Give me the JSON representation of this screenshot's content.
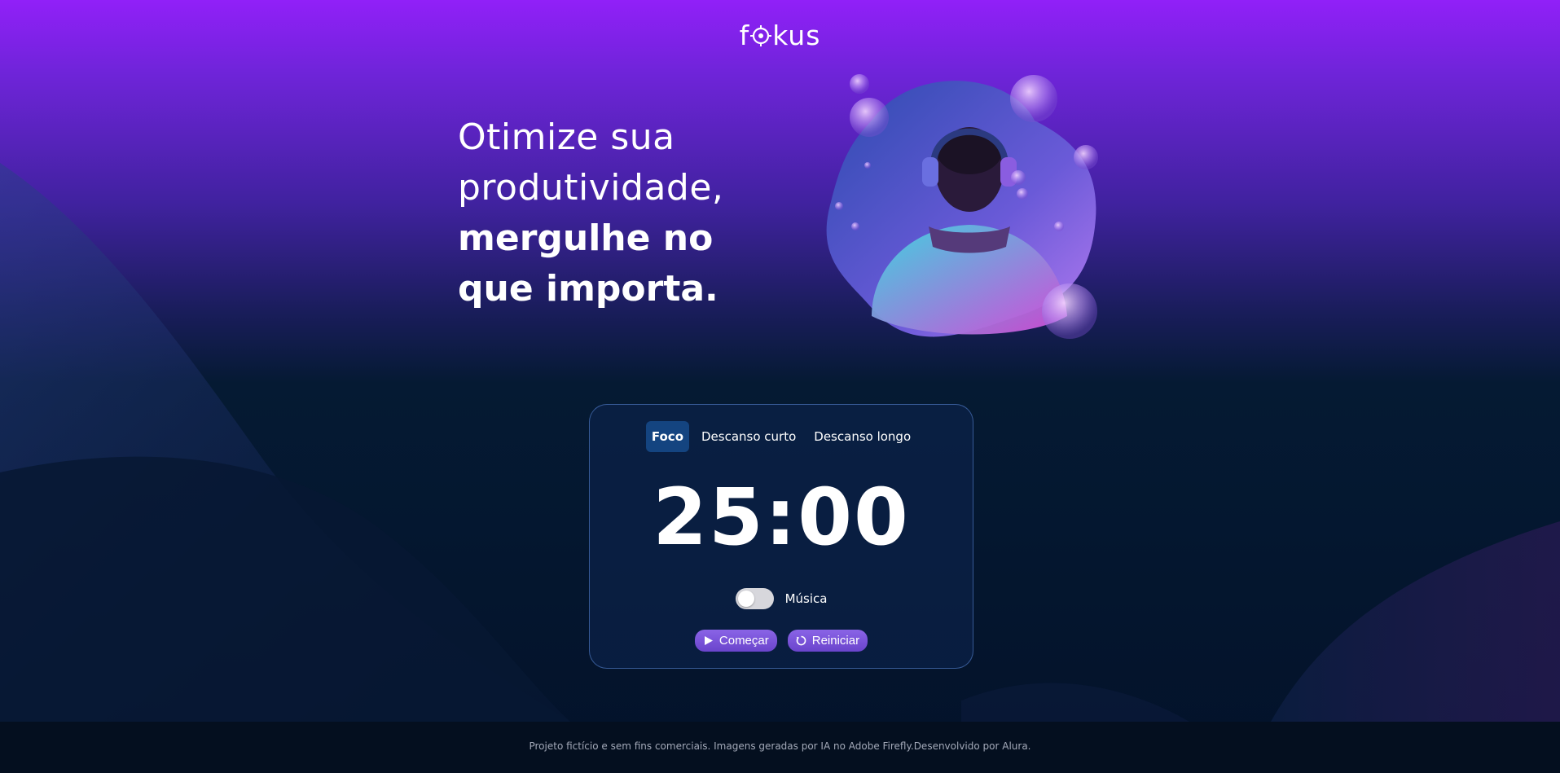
{
  "brand": {
    "logo_prefix": "f",
    "logo_suffix": "kus",
    "logo_icon": "target-o-icon"
  },
  "hero": {
    "line1": "Otimize sua",
    "line2": "produtividade,",
    "line3": "mergulhe no",
    "line4": "que importa.",
    "image": "astronaut-with-headphones-and-bubbles"
  },
  "timer_card": {
    "tabs": [
      {
        "label": "Foco",
        "active": true
      },
      {
        "label": "Descanso curto",
        "active": false
      },
      {
        "label": "Descanso longo",
        "active": false
      }
    ],
    "time": "25:00",
    "music_label": "Música",
    "music_on": false,
    "start_label": "Começar",
    "start_icon": "play-icon",
    "reset_label": "Reiniciar",
    "reset_icon": "restart-icon"
  },
  "footer": {
    "text": "Projeto fictício e sem fins comerciais. Imagens geradas por IA no Adobe Firefly.Desenvolvido por Alura."
  },
  "colors": {
    "top": "#9120f8",
    "bottom": "#03122a",
    "active_tab": "#144480",
    "button": "#7b55de"
  }
}
